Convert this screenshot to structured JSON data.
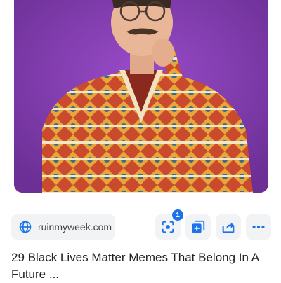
{
  "result": {
    "image_alt": "Man in patterned dashiki shirt with glasses and mustache, hand on chin, purple background",
    "source": {
      "domain": "ruinmyweek.com",
      "icon": "globe-icon"
    },
    "title": "29 Black Lives Matter Memes That Belong In A Future ..."
  },
  "actions": {
    "lens": {
      "icon": "lens-icon",
      "badge_count": "1"
    },
    "collections": {
      "icon": "add-to-collection-icon"
    },
    "share": {
      "icon": "share-icon"
    },
    "more": {
      "icon": "more-options-icon"
    }
  },
  "colors": {
    "accent": "#1a73e8",
    "chip_background": "#f1f3f4",
    "image_background": "#7a3aa7"
  }
}
